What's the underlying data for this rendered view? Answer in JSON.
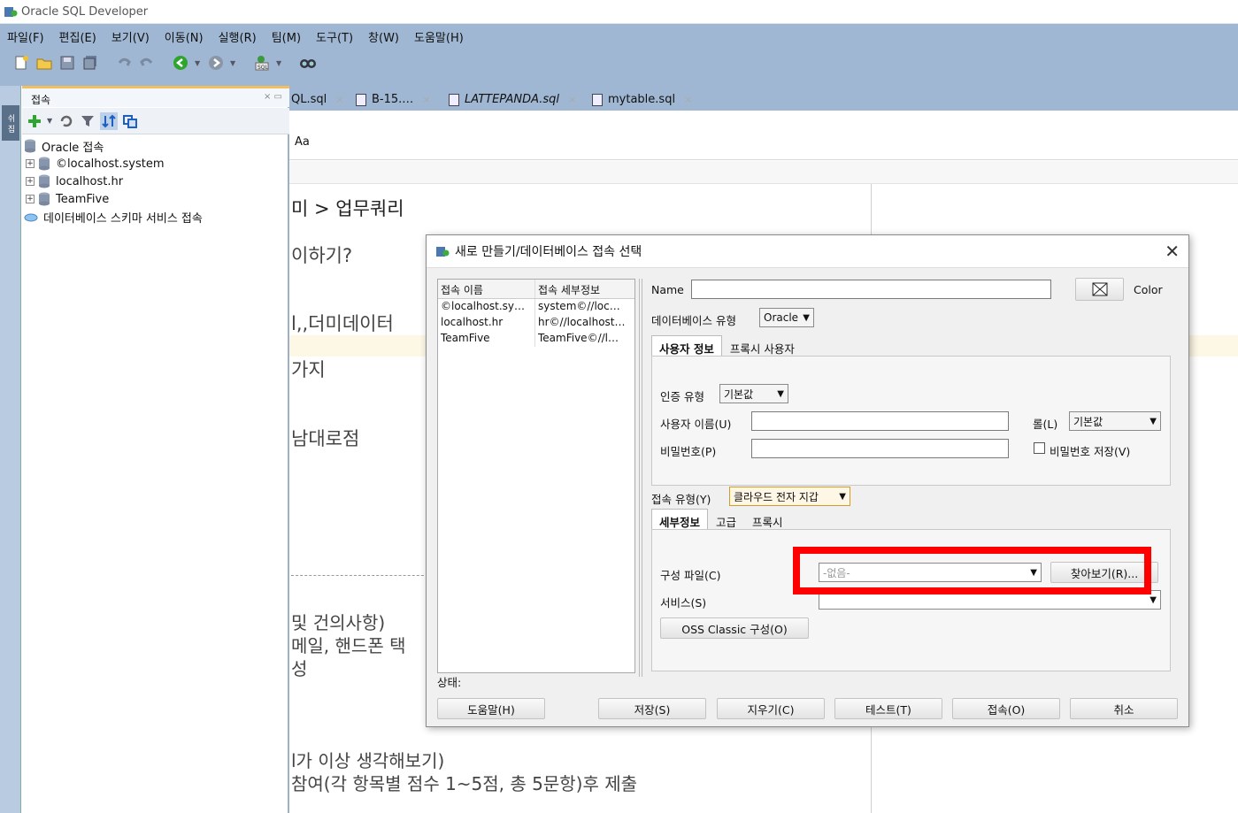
{
  "window": {
    "title": "Oracle SQL Developer"
  },
  "menu": [
    "파일(F)",
    "편집(E)",
    "보기(V)",
    "이동(N)",
    "실행(R)",
    "팀(M)",
    "도구(T)",
    "창(W)",
    "도움말(H)"
  ],
  "toolbar_icons": [
    "new-icon",
    "open-icon",
    "save-icon",
    "save-all-icon",
    "undo-icon",
    "redo-icon",
    "back-icon",
    "forward-icon",
    "sql-icon",
    "find-icon"
  ],
  "left_strip": {
    "tab_label": "쉬 집"
  },
  "connections_panel": {
    "title": "접속",
    "tree": [
      {
        "label": "Oracle 접속",
        "type": "root"
      },
      {
        "label": "©localhost.system",
        "type": "db"
      },
      {
        "label": "localhost.hr",
        "type": "db"
      },
      {
        "label": "TeamFive",
        "type": "db"
      },
      {
        "label": "데이터베이스 스키마 서비스 접속",
        "type": "cloud"
      }
    ]
  },
  "editor_tabs": [
    {
      "label": "QL.sql",
      "italic": false
    },
    {
      "label": "B-15.…",
      "italic": false
    },
    {
      "label": "LATTEPANDA.sql",
      "italic": true
    },
    {
      "label": "mytable.sql",
      "italic": false
    }
  ],
  "editor_toolbar": {
    "aa": "Aa"
  },
  "editor_lines": [
    "미 > 업무쿼리",
    "이하기?",
    "l,,더미데이터",
    "가지",
    "남대로점",
    "및 건의사항)",
    "메일, 핸드폰 택",
    "성",
    "l가 이상 생각해보기)",
    "참여(각 항목별 점수 1~5점, 총 5문항)후 제출"
  ],
  "dialog": {
    "title": "새로 만들기/데이터베이스 접속 선택",
    "list_headers": [
      "접속 이름",
      "접속 세부정보"
    ],
    "list_rows": [
      [
        "©localhost.sy…",
        "system©//loc…"
      ],
      [
        "localhost.hr",
        "hr©//localhost…"
      ],
      [
        "TeamFive",
        "TeamFive©//l…"
      ]
    ],
    "name_label": "Name",
    "name_value": "",
    "color_label": "Color",
    "db_type_label": "데이터베이스 유형",
    "db_type_value": "Oracle",
    "user_tabs": [
      "사용자 정보",
      "프록시 사용자"
    ],
    "auth_type_label": "인증 유형",
    "auth_type_value": "기본값",
    "username_label": "사용자 이름(U)",
    "username_value": "",
    "role_label": "롤(L)",
    "role_value": "기본값",
    "password_label": "비밀번호(P)",
    "password_value": "",
    "save_password_label": "비밀번호 저장(V)",
    "conn_type_label": "접속 유형(Y)",
    "conn_type_value": "클라우드 전자 지갑",
    "detail_tabs": [
      "세부정보",
      "고급",
      "프록시"
    ],
    "config_file_label": "구성 파일(C)",
    "config_file_value": "-없음-",
    "browse_button": "찾아보기(R)...",
    "service_label": "서비스(S)",
    "service_value": "",
    "oss_button": "OSS Classic 구성(O)",
    "status_label": "상태:",
    "buttons": {
      "help": "도움말(H)",
      "save": "저장(S)",
      "clear": "지우기(C)",
      "test": "테스트(T)",
      "connect": "접속(O)",
      "cancel": "취소"
    }
  },
  "highlight_color": "#ff0000"
}
